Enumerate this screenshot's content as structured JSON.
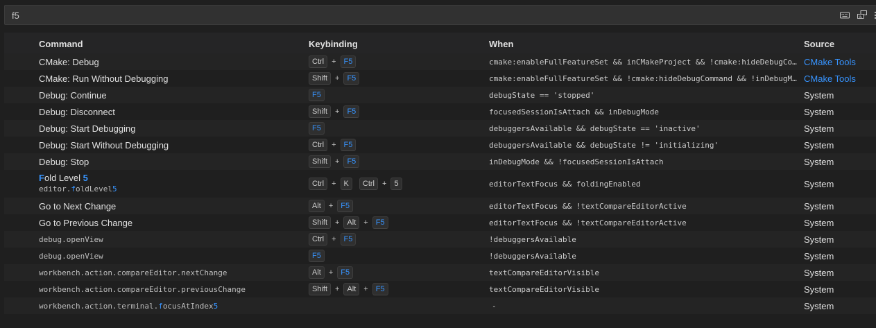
{
  "search": {
    "value": "f5"
  },
  "actions": {
    "record_keys_icon": "keyboard-icon",
    "sort_icon": "sort-precedence-icon"
  },
  "columns": {
    "command": "Command",
    "keybinding": "Keybinding",
    "when": "When",
    "source": "Source"
  },
  "rows": [
    {
      "command": "CMake: Debug",
      "keys": [
        [
          "Ctrl",
          "F5"
        ]
      ],
      "when": "cmake:enableFullFeatureSet && inCMakeProject && !cmake:hideDebugComm…",
      "source": "CMake Tools"
    },
    {
      "command": "CMake: Run Without Debugging",
      "keys": [
        [
          "Shift",
          "F5"
        ]
      ],
      "when": "cmake:enableFullFeatureSet && !cmake:hideDebugCommand && !inDebugMode",
      "source": "CMake Tools"
    },
    {
      "command": "Debug: Continue",
      "keys": [
        [
          "F5"
        ]
      ],
      "when": "debugState == 'stopped'",
      "source": "System"
    },
    {
      "command": "Debug: Disconnect",
      "keys": [
        [
          "Shift",
          "F5"
        ]
      ],
      "when": "focusedSessionIsAttach && inDebugMode",
      "source": "System"
    },
    {
      "command": "Debug: Start Debugging",
      "keys": [
        [
          "F5"
        ]
      ],
      "when": "debuggersAvailable && debugState == 'inactive'",
      "source": "System"
    },
    {
      "command": "Debug: Start Without Debugging",
      "keys": [
        [
          "Ctrl",
          "F5"
        ]
      ],
      "when": "debuggersAvailable && debugState != 'initializing'",
      "source": "System"
    },
    {
      "command": "Debug: Stop",
      "keys": [
        [
          "Shift",
          "F5"
        ]
      ],
      "when": "inDebugMode && !focusedSessionIsAttach",
      "source": "System"
    },
    {
      "command_parts": [
        "F",
        "old Level ",
        "5"
      ],
      "command_id_parts": [
        "editor.",
        "f",
        "oldLevel",
        "5"
      ],
      "keys": [
        [
          "Ctrl",
          "K"
        ],
        [
          "Ctrl",
          "5"
        ]
      ],
      "when": "editorTextFocus && foldingEnabled",
      "source": "System"
    },
    {
      "command": "Go to Next Change",
      "keys": [
        [
          "Alt",
          "F5"
        ]
      ],
      "when": "editorTextFocus && !textCompareEditorActive",
      "source": "System"
    },
    {
      "command": "Go to Previous Change",
      "keys": [
        [
          "Shift",
          "Alt",
          "F5"
        ]
      ],
      "when": "editorTextFocus && !textCompareEditorActive",
      "source": "System"
    },
    {
      "command_id": "debug.openView",
      "keys": [
        [
          "Ctrl",
          "F5"
        ]
      ],
      "when": "!debuggersAvailable",
      "source": "System"
    },
    {
      "command_id": "debug.openView",
      "keys": [
        [
          "F5"
        ]
      ],
      "when": "!debuggersAvailable",
      "source": "System"
    },
    {
      "command_id": "workbench.action.compareEditor.nextChange",
      "keys": [
        [
          "Alt",
          "F5"
        ]
      ],
      "when": "textCompareEditorVisible",
      "source": "System"
    },
    {
      "command_id": "workbench.action.compareEditor.previousChange",
      "keys": [
        [
          "Shift",
          "Alt",
          "F5"
        ]
      ],
      "when": "textCompareEditorVisible",
      "source": "System"
    },
    {
      "command_id_parts": [
        "workbench.action.terminal.",
        "f",
        "ocusAtIndex",
        "5"
      ],
      "keys": [],
      "when": "-",
      "source": "System"
    }
  ]
}
